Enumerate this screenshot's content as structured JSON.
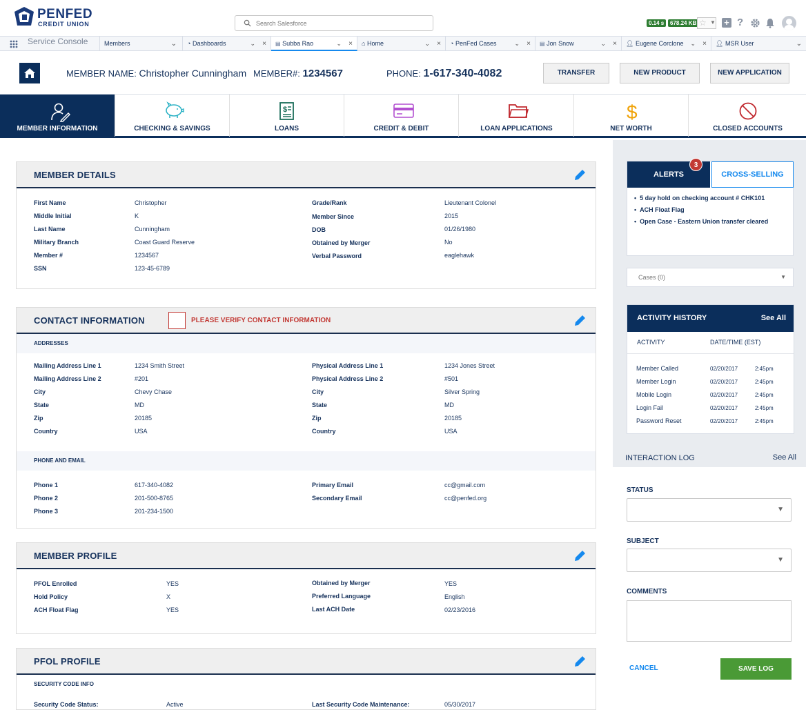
{
  "brand": {
    "name_line1": "PENFED",
    "name_line2": "CREDIT UNION"
  },
  "search": {
    "placeholder": "Search Salesforce"
  },
  "stats": {
    "time": "0.14 s",
    "size": "678.24 KB"
  },
  "console": {
    "label": "Service Console"
  },
  "tabs": [
    {
      "label": "Members"
    },
    {
      "label": "Dashboards"
    },
    {
      "label": "Subba Rao"
    },
    {
      "label": "Home"
    },
    {
      "label": "PenFed Cases"
    },
    {
      "label": "Jon Snow"
    },
    {
      "label": "Eugene Corclone"
    },
    {
      "label": "MSR User"
    }
  ],
  "member_bar": {
    "name_label": "MEMBER NAME:",
    "name_value": "Christopher Cunningham",
    "number_label": "MEMBER#:",
    "number_value": "1234567",
    "phone_label": "PHONE:",
    "phone_value": "1-617-340-4082",
    "btn_transfer": "TRANSFER",
    "btn_new_product": "NEW PRODUCT",
    "btn_new_application": "NEW APPLICATION"
  },
  "nav": [
    {
      "label": "MEMBER INFORMATION",
      "icon": "member-icon"
    },
    {
      "label": "CHECKING & SAVINGS",
      "icon": "piggy-bank-icon"
    },
    {
      "label": "LOANS",
      "icon": "document-dollar-icon"
    },
    {
      "label": "CREDIT & DEBIT",
      "icon": "credit-card-icon"
    },
    {
      "label": "LOAN APPLICATIONS",
      "icon": "folder-icon"
    },
    {
      "label": "NET WORTH",
      "icon": "dollar-icon"
    },
    {
      "label": "CLOSED ACCOUNTS",
      "icon": "prohibited-icon"
    }
  ],
  "member_details": {
    "title": "MEMBER DETAILS",
    "left": [
      {
        "k": "First Name",
        "v": "Christopher"
      },
      {
        "k": "Middle Initial",
        "v": "K"
      },
      {
        "k": "Last Name",
        "v": "Cunningham"
      },
      {
        "k": "Military Branch",
        "v": "Coast Guard Reserve"
      },
      {
        "k": "Member #",
        "v": "1234567"
      },
      {
        "k": "SSN",
        "v": "123-45-6789"
      }
    ],
    "right": [
      {
        "k": "Grade/Rank",
        "v": "Lieutenant Colonel"
      },
      {
        "k": "Member Since",
        "v": "2015"
      },
      {
        "k": "DOB",
        "v": "01/26/1980"
      },
      {
        "k": "Obtained by Merger",
        "v": "No"
      },
      {
        "k": "Verbal Password",
        "v": "eaglehawk"
      }
    ]
  },
  "contact": {
    "title": "CONTACT INFORMATION",
    "verify_label": "PLEASE VERIFY CONTACT INFORMATION",
    "addresses_label": "ADDRESSES",
    "left": [
      {
        "k": "Mailing Address Line 1",
        "v": "1234 Smith Street"
      },
      {
        "k": "Mailing Address Line 2",
        "v": "#201"
      },
      {
        "k": "City",
        "v": "Chevy Chase"
      },
      {
        "k": "State",
        "v": "MD"
      },
      {
        "k": "Zip",
        "v": "20185"
      },
      {
        "k": "Country",
        "v": "USA"
      }
    ],
    "right": [
      {
        "k": "Physical Address Line 1",
        "v": "1234 Jones Street"
      },
      {
        "k": "Physical Address Line 2",
        "v": "#501"
      },
      {
        "k": "City",
        "v": "Silver Spring"
      },
      {
        "k": "State",
        "v": "MD"
      },
      {
        "k": "Zip",
        "v": "20185"
      },
      {
        "k": "Country",
        "v": "USA"
      }
    ],
    "phone_email_label": "PHONE AND EMAIL",
    "phones": [
      {
        "k": "Phone 1",
        "v": "617-340-4082"
      },
      {
        "k": "Phone 2",
        "v": "201-500-8765"
      },
      {
        "k": "Phone 3",
        "v": "201-234-1500"
      }
    ],
    "emails": [
      {
        "k": "Primary Email",
        "v": "cc@gmail.com"
      },
      {
        "k": "Secondary Email",
        "v": "cc@penfed.org"
      }
    ]
  },
  "member_profile": {
    "title": "MEMBER PROFILE",
    "left": [
      {
        "k": "PFOL Enrolled",
        "v": "YES"
      },
      {
        "k": "Hold Policy",
        "v": "X"
      },
      {
        "k": "ACH Float Flag",
        "v": "YES"
      }
    ],
    "right": [
      {
        "k": "Obtained by Merger",
        "v": "YES"
      },
      {
        "k": "Preferred Language",
        "v": "English"
      },
      {
        "k": "Last ACH Date",
        "v": "02/23/2016"
      }
    ]
  },
  "pfol_profile": {
    "title": "PFOL PROFILE",
    "sub_label": "SECURITY CODE INFO",
    "left_k": "Security Code Status:",
    "left_v": "Active",
    "right_k": "Last Security Code Maintenance:",
    "right_v": "05/30/2017"
  },
  "alerts": {
    "tab_alerts": "ALERTS",
    "tab_cross": "CROSS-SELLING",
    "count": "3",
    "items": [
      "5 day hold on checking account # CHK101",
      "ACH Float Flag",
      "Open Case - Eastern Union transfer cleared"
    ]
  },
  "cases": {
    "label": "Cases (0)"
  },
  "activity": {
    "title": "ACTIVITY HISTORY",
    "see_all": "See All",
    "col_activity": "ACTIVITY",
    "col_date": "DATE/TIME (EST)",
    "rows": [
      {
        "activity": "Member Called",
        "date": "02/20/2017",
        "time": "2:45pm"
      },
      {
        "activity": "Member Login",
        "date": "02/20/2017",
        "time": "2:45pm"
      },
      {
        "activity": "Mobile Login",
        "date": "02/20/2017",
        "time": "2:45pm"
      },
      {
        "activity": "Login Fail",
        "date": "02/20/2017",
        "time": "2:45pm"
      },
      {
        "activity": "Password Reset",
        "date": "02/20/2017",
        "time": "2:45pm"
      }
    ]
  },
  "interaction_log": {
    "title": "INTERACTION LOG",
    "see_all": "See All",
    "status_label": "STATUS",
    "subject_label": "SUBJECT",
    "comments_label": "COMMENTS",
    "cancel": "CANCEL",
    "save": "SAVE LOG"
  },
  "colors": {
    "navy": "#0b2e5b",
    "accent": "#1589ee",
    "alert_red": "#c23934",
    "save_green": "#4a9a36"
  }
}
